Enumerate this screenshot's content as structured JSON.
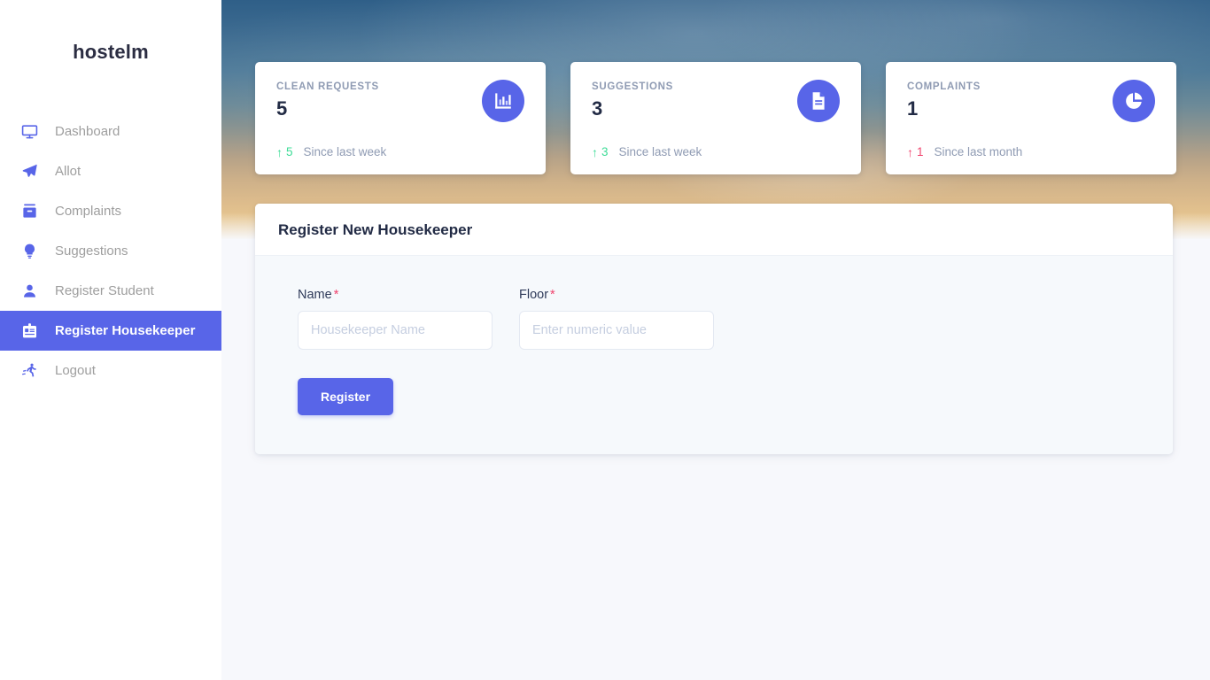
{
  "sidebar": {
    "brand": "hostelm",
    "items": [
      {
        "label": "Dashboard",
        "icon": "monitor-icon",
        "active": false
      },
      {
        "label": "Allot",
        "icon": "paper-plane-icon",
        "active": false
      },
      {
        "label": "Complaints",
        "icon": "archive-icon",
        "active": false
      },
      {
        "label": "Suggestions",
        "icon": "lightbulb-icon",
        "active": false
      },
      {
        "label": "Register Student",
        "icon": "user-icon",
        "active": false
      },
      {
        "label": "Register Housekeeper",
        "icon": "id-badge-icon",
        "active": true
      },
      {
        "label": "Logout",
        "icon": "running-icon",
        "active": false
      }
    ]
  },
  "stats": [
    {
      "title": "CLEAN REQUESTS",
      "value": "5",
      "icon": "bar-chart-icon",
      "trend_arrow": "↑",
      "trend_value": "5",
      "trend_text": "Since last week",
      "trend_direction": "up",
      "trend_color": "#3ddc97"
    },
    {
      "title": "SUGGESTIONS",
      "value": "3",
      "icon": "document-icon",
      "trend_arrow": "↑",
      "trend_value": "3",
      "trend_text": "Since last week",
      "trend_direction": "up",
      "trend_color": "#3ddc97"
    },
    {
      "title": "COMPLAINTS",
      "value": "1",
      "icon": "pie-chart-icon",
      "trend_arrow": "↑",
      "trend_value": "1",
      "trend_text": "Since last month",
      "trend_direction": "down",
      "trend_color": "#f0436d"
    }
  ],
  "panel": {
    "title": "Register New Housekeeper",
    "fields": [
      {
        "label": "Name",
        "required_mark": "*",
        "placeholder": "Housekeeper Name",
        "value": ""
      },
      {
        "label": "Floor",
        "required_mark": "*",
        "placeholder": "Enter numeric value",
        "value": ""
      }
    ],
    "submit_label": "Register"
  },
  "theme": {
    "accent": "#5865e8",
    "text_dark": "#222b45",
    "text_muted": "#8f9bb3",
    "success": "#3ddc97",
    "danger": "#f0436d",
    "page_bg": "#f7f8fc"
  }
}
